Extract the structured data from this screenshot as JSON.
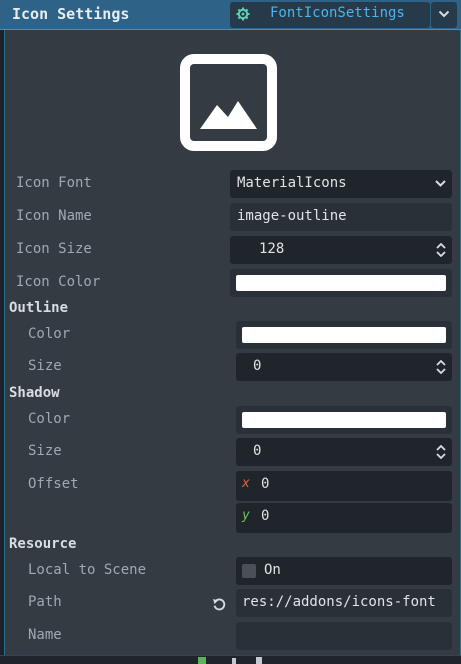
{
  "header": {
    "title": "Icon Settings",
    "resource_name": "FontIconSettings",
    "resource_icon": "gear-icon",
    "dropdown_icon": "chevron-down-icon"
  },
  "preview": {
    "icon": "image-outline-icon"
  },
  "icon_font": {
    "label": "Icon Font",
    "value": "MaterialIcons"
  },
  "icon_name": {
    "label": "Icon Name",
    "value": "image-outline"
  },
  "icon_size": {
    "label": "Icon Size",
    "value": "128"
  },
  "icon_color": {
    "label": "Icon Color",
    "color": "#ffffff"
  },
  "outline": {
    "title": "Outline",
    "color_label": "Color",
    "color": "#ffffff",
    "size_label": "Size",
    "size": "0"
  },
  "shadow": {
    "title": "Shadow",
    "color_label": "Color",
    "color": "#ffffff",
    "size_label": "Size",
    "size": "0",
    "offset_label": "Offset",
    "offset_x_label": "x",
    "offset_x": "0",
    "offset_y_label": "y",
    "offset_y": "0"
  },
  "resource": {
    "title": "Resource",
    "local_label": "Local to Scene",
    "local_value": "On",
    "path_label": "Path",
    "path_value": "res://addons/icons-font",
    "name_label": "Name",
    "name_value": ""
  },
  "colors": {
    "header_bg": "#2e6387",
    "accent": "#4cb4f0",
    "panel_bg": "#343b43",
    "field_bg": "#20252b",
    "axis_x": "#e0623f",
    "axis_y": "#6ec25a"
  }
}
